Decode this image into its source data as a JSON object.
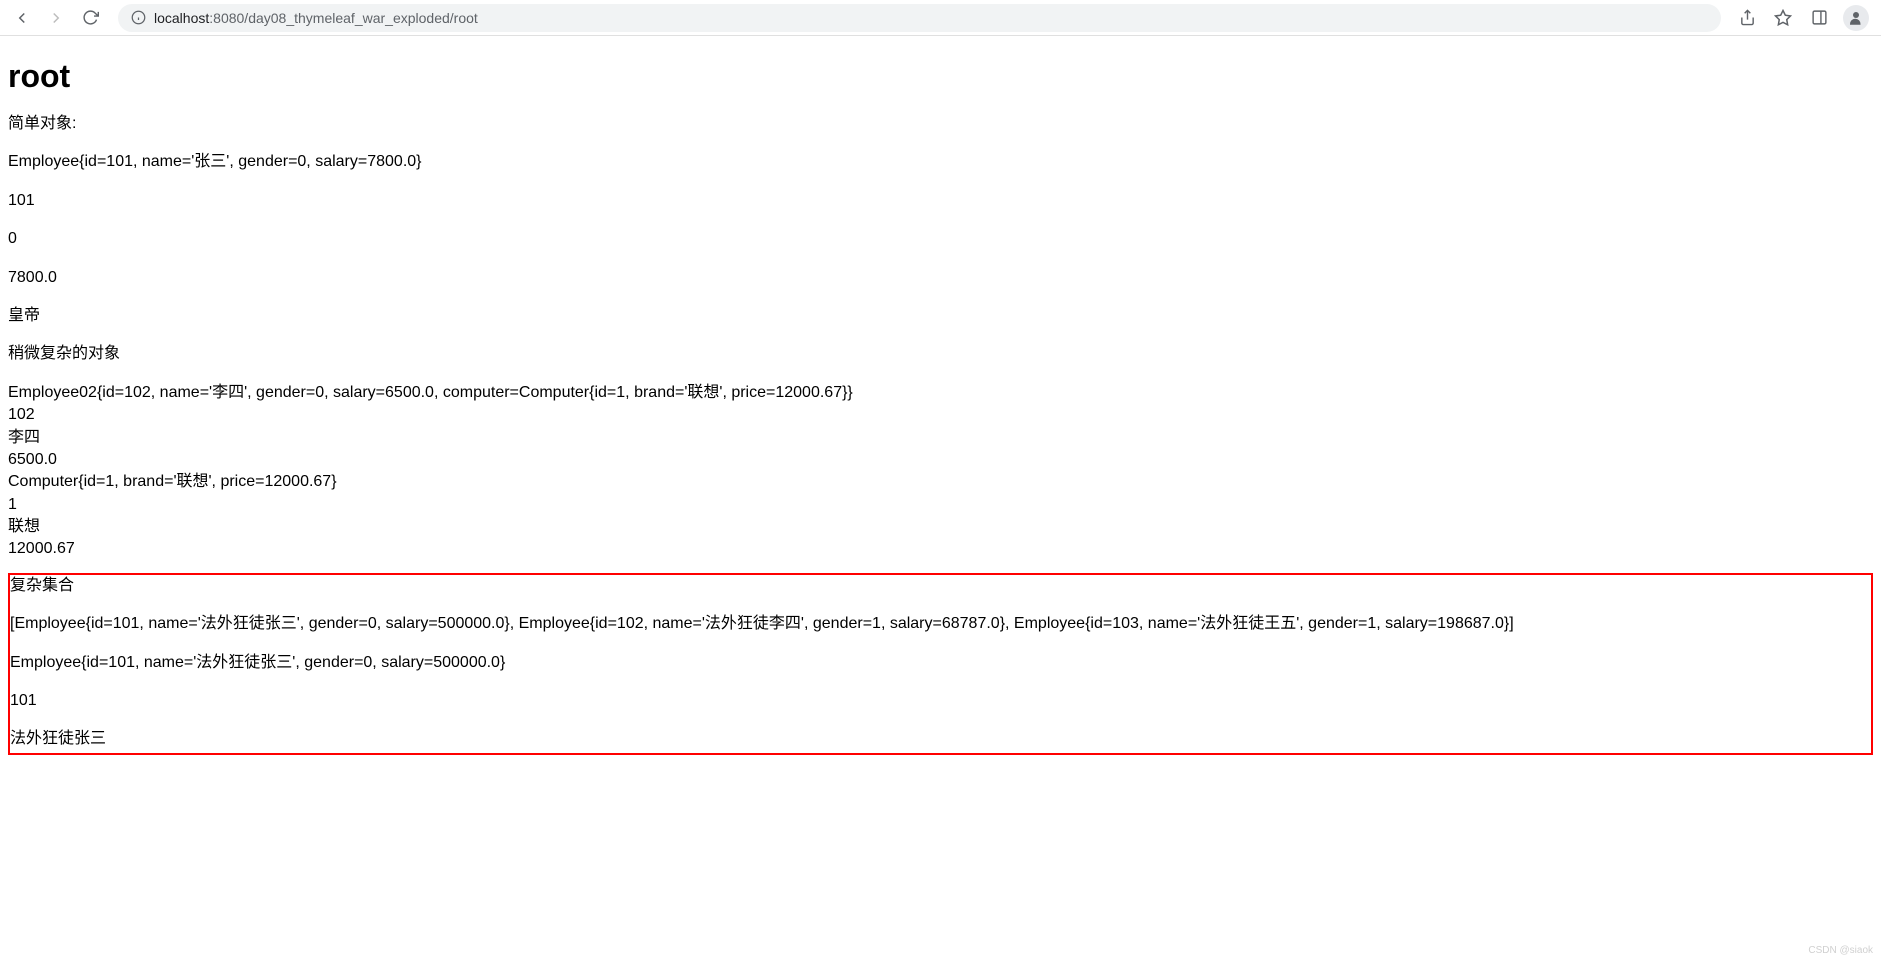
{
  "toolbar": {
    "url_host": "localhost",
    "url_port_path": ":8080/day08_thymeleaf_war_exploded/root"
  },
  "page": {
    "heading": "root",
    "simple_label": "简单对象:",
    "employee_str": "Employee{id=101, name='张三', gender=0, salary=7800.0}",
    "emp_id": "101",
    "emp_gender": "0",
    "emp_salary": "7800.0",
    "emperor": "皇帝",
    "complex_label": "稍微复杂的对象",
    "employee02_str": "Employee02{id=102, name='李四', gender=0, salary=6500.0, computer=Computer{id=1, brand='联想', price=12000.67}}",
    "emp2_id": "102",
    "emp2_name": "李四",
    "emp2_salary": "6500.0",
    "computer_str": "Computer{id=1, brand='联想', price=12000.67}",
    "comp_id": "1",
    "comp_brand": "联想",
    "comp_price": "12000.67"
  },
  "collection": {
    "label": "复杂集合",
    "list_str": "[Employee{id=101, name='法外狂徒张三', gender=0, salary=500000.0}, Employee{id=102, name='法外狂徒李四', gender=1, salary=68787.0}, Employee{id=103, name='法外狂徒王五', gender=1, salary=198687.0}]",
    "first_emp": "Employee{id=101, name='法外狂徒张三', gender=0, salary=500000.0}",
    "first_id": "101",
    "first_name": "法外狂徒张三"
  },
  "watermark": "CSDN @siaok"
}
